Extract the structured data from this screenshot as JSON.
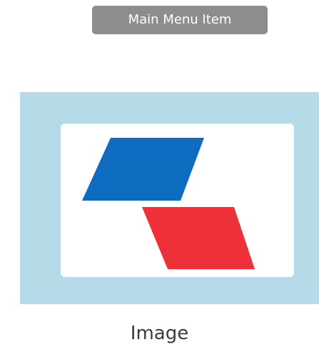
{
  "menu": {
    "label": "Main Menu Item"
  },
  "image": {
    "icon": "parallelograms-logo-icon",
    "colors": {
      "frame_background": "#b5dbe8",
      "card_background": "#ffffff",
      "blue_shape": "#0d6cbf",
      "red_shape": "#ee3039"
    }
  },
  "caption": {
    "text": "Image"
  }
}
